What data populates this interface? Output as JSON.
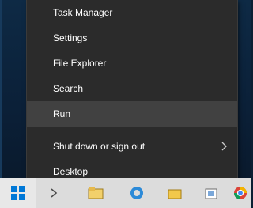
{
  "menu": {
    "items": [
      {
        "label": "Task Manager"
      },
      {
        "label": "Settings"
      },
      {
        "label": "File Explorer"
      },
      {
        "label": "Search"
      },
      {
        "label": "Run",
        "highlighted": true
      },
      {
        "label": "Shut down or sign out",
        "has_submenu": true
      },
      {
        "label": "Desktop"
      }
    ]
  },
  "colors": {
    "menu_bg": "#2b2b2b",
    "menu_highlight": "#414141",
    "menu_text": "#ffffff",
    "windows_blue": "#0078d7"
  },
  "taskbar": {
    "icons": [
      "windows-start-icon",
      "task-view-icon",
      "file-explorer-icon",
      "edge-icon",
      "folder-icon",
      "store-icon",
      "chrome-icon"
    ]
  }
}
